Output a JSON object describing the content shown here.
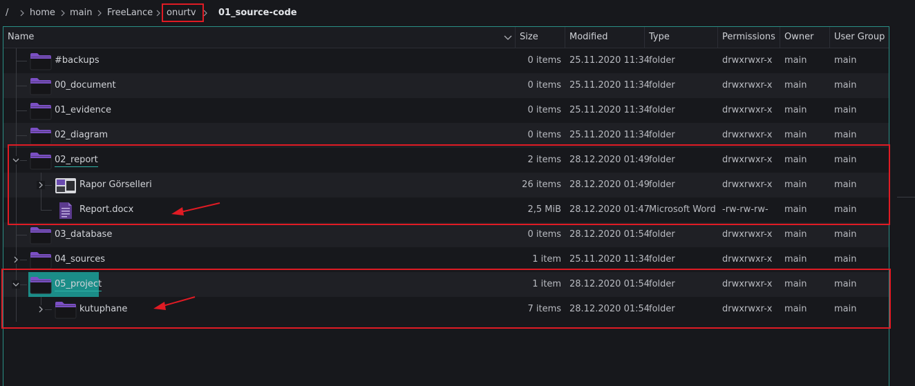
{
  "breadcrumb": [
    {
      "label": "/"
    },
    {
      "label": "home"
    },
    {
      "label": "main"
    },
    {
      "label": "FreeLance"
    },
    {
      "label": "onurtv"
    },
    {
      "label": "01_source-code"
    }
  ],
  "columns": {
    "name": "Name",
    "size": "Size",
    "modified": "Modified",
    "type": "Type",
    "permissions": "Permissions",
    "owner": "Owner",
    "group": "User Group"
  },
  "rows": [
    {
      "name": "#backups",
      "size": "0 items",
      "modified": "25.11.2020 11:34",
      "type": "folder",
      "permissions": "drwxrwxr-x",
      "owner": "main",
      "group": "main",
      "icon": "folder-icon"
    },
    {
      "name": "00_document",
      "size": "0 items",
      "modified": "25.11.2020 11:34",
      "type": "folder",
      "permissions": "drwxrwxr-x",
      "owner": "main",
      "group": "main",
      "icon": "folder-icon"
    },
    {
      "name": "01_evidence",
      "size": "0 items",
      "modified": "25.11.2020 11:34",
      "type": "folder",
      "permissions": "drwxrwxr-x",
      "owner": "main",
      "group": "main",
      "icon": "folder-icon"
    },
    {
      "name": "02_diagram",
      "size": "0 items",
      "modified": "25.11.2020 11:34",
      "type": "folder",
      "permissions": "drwxrwxr-x",
      "owner": "main",
      "group": "main",
      "icon": "folder-icon"
    },
    {
      "name": "02_report",
      "size": "2 items",
      "modified": "28.12.2020 01:49",
      "type": "folder",
      "permissions": "drwxrwxr-x",
      "owner": "main",
      "group": "main",
      "icon": "folder-icon",
      "expanded": true
    },
    {
      "name": "Rapor Görselleri",
      "size": "26 items",
      "modified": "28.12.2020 01:49",
      "type": "folder",
      "permissions": "drwxrwxr-x",
      "owner": "main",
      "group": "main",
      "icon": "image-folder-icon",
      "collapsed": true
    },
    {
      "name": "Report.docx",
      "size": "2,5 MiB",
      "modified": "28.12.2020 01:47",
      "type": "Microsoft Word",
      "permissions": "-rw-rw-rw-",
      "owner": "main",
      "group": "main",
      "icon": "word-document-icon"
    },
    {
      "name": "03_database",
      "size": "0 items",
      "modified": "28.12.2020 01:54",
      "type": "folder",
      "permissions": "drwxrwxr-x",
      "owner": "main",
      "group": "main",
      "icon": "folder-icon"
    },
    {
      "name": "04_sources",
      "size": "1 item",
      "modified": "25.11.2020 11:34",
      "type": "folder",
      "permissions": "drwxrwxr-x",
      "owner": "main",
      "group": "main",
      "icon": "folder-icon",
      "collapsed": true
    },
    {
      "name": "05_project",
      "size": "1 item",
      "modified": "28.12.2020 01:54",
      "type": "folder",
      "permissions": "drwxrwxr-x",
      "owner": "main",
      "group": "main",
      "icon": "folder-icon",
      "expanded": true,
      "selected": true
    },
    {
      "name": "kutuphane",
      "size": "7 items",
      "modified": "28.12.2020 01:54",
      "type": "folder",
      "permissions": "drwxrwxr-x",
      "owner": "main",
      "group": "main",
      "icon": "folder-icon",
      "collapsed": true
    }
  ],
  "colors": {
    "background": "#17181c",
    "alt_row": "#1f2025",
    "selection": "#1b8d88",
    "folder": "#7b4fc4",
    "annotation": "#e01b24"
  }
}
